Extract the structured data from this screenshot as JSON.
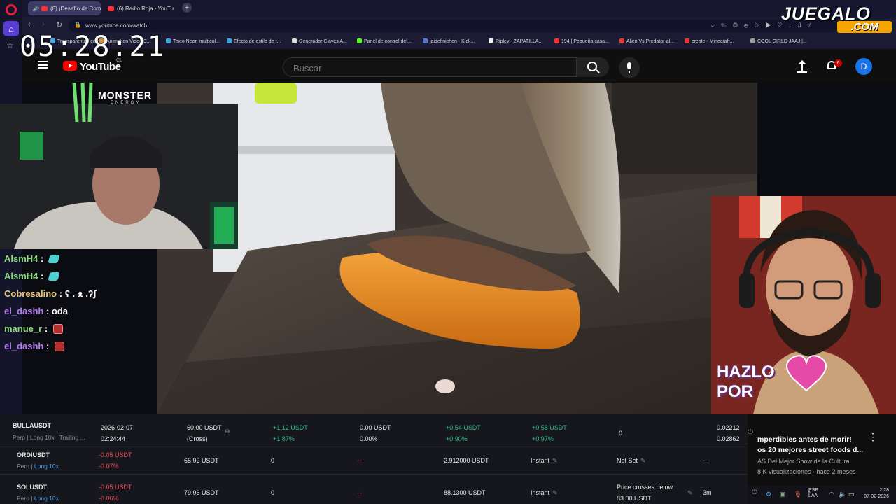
{
  "browser": {
    "tabs": [
      {
        "label": "(6) ¡Desafío de Comid"
      },
      {
        "label": "(6) Radio Roja - YouTube"
      }
    ],
    "new_tab": "+",
    "url": "www.youtube.com/watch",
    "bookmarks": [
      {
        "label": "Transparenta / comi..."
      },
      {
        "label": "Animation Video C..."
      },
      {
        "label": "Texto Neon multicol..."
      },
      {
        "label": "Efecto de estilo de t..."
      },
      {
        "label": "Generador Claves A..."
      },
      {
        "label": "Panel de control del..."
      },
      {
        "label": "jaidefinichon - Kick..."
      },
      {
        "label": "Ripley - ZAPATILLA..."
      },
      {
        "label": "194 | Pequeña casa..."
      },
      {
        "label": "Alien Vs Predator-al..."
      },
      {
        "label": "create - Minecraft..."
      },
      {
        "label": "COOL GIRLD JAAJ |..."
      }
    ]
  },
  "youtube": {
    "logo_text": "YouTube",
    "country_code": "CL",
    "search_placeholder": "Buscar",
    "notification_count": "6",
    "avatar_letter": "D"
  },
  "stream": {
    "clock": "05:28:21",
    "watermark_top": "JUEGALO",
    "watermark_bottom": ".COM",
    "monster_text": "MONSTER",
    "monster_sub": "ENERGY",
    "overlay_text": "HAZLO POR",
    "chat": [
      {
        "user": "AlsmH4",
        "msg": "",
        "emote": "blue",
        "user_color": "#8bdc7a"
      },
      {
        "user": "AlsmH4",
        "msg": "",
        "emote": "blue",
        "user_color": "#8bdc7a"
      },
      {
        "user": "Cobresalino",
        "msg": "ʕ . ᴥ .ʔʃ",
        "emote": "",
        "user_color": "#e8c77a"
      },
      {
        "user": "el_dashh",
        "msg": "oda",
        "emote": "",
        "user_color": "#b57cf0"
      },
      {
        "user": "manue_r",
        "msg": "",
        "emote": "red",
        "user_color": "#8bdc7a"
      },
      {
        "user": "el_dashh",
        "msg": "",
        "emote": "red",
        "user_color": "#b57cf0"
      }
    ]
  },
  "trading": {
    "rows": [
      {
        "symbol": "BULLAUSDT",
        "type": "Perp | Long 10x | Trailing ...",
        "date": "2026-02-07",
        "time": "02:24:44",
        "margin": "60.00 USDT",
        "margin_mode": "(Cross)",
        "pnl1": "+1.12 USDT",
        "pnl1_pct": "+1.87%",
        "val": "0.00 USDT",
        "val_pct": "0.00%",
        "pnl2": "+0.54 USDT",
        "pnl2_pct": "+0.90%",
        "pnl3": "+0.58 USDT",
        "pnl3_pct": "+0.97%",
        "qty": "0",
        "price_a": "0.02212",
        "price_b": "0.02862"
      },
      {
        "symbol": "ORDIUSDT",
        "type_prefix": "Perp",
        "type_lev": "Long 10x",
        "pnl": "-0.05 USDT",
        "pnl_pct": "-0.07%",
        "margin": "65.92 USDT",
        "qty": "0",
        "dash": "--",
        "price": "2.912000 USDT",
        "mode": "Instant",
        "tp": "Not Set",
        "end": "--"
      },
      {
        "symbol": "SOLUSDT",
        "type_prefix": "Perp",
        "type_lev": "Long 10x",
        "pnl": "-0.05 USDT",
        "pnl_pct": "-0.06%",
        "margin": "79.96 USDT",
        "qty": "0",
        "dash": "--",
        "price": "88.1300 USDT",
        "mode": "Instant",
        "cond1": "Price crosses below",
        "cond2": "83.00 USDT",
        "duration": "3m"
      }
    ]
  },
  "recommendation": {
    "title1": "mperdibles antes de morir!",
    "title2": "os 20 mejores street foods d...",
    "channel": "AS Del Mejor Show de la Cultura",
    "meta": "8 K visualizaciones · hace 2 meses"
  },
  "taskbar": {
    "lang1": "ESP",
    "lang2": "LAA",
    "time": "2:28",
    "date": "07-02-2026"
  }
}
